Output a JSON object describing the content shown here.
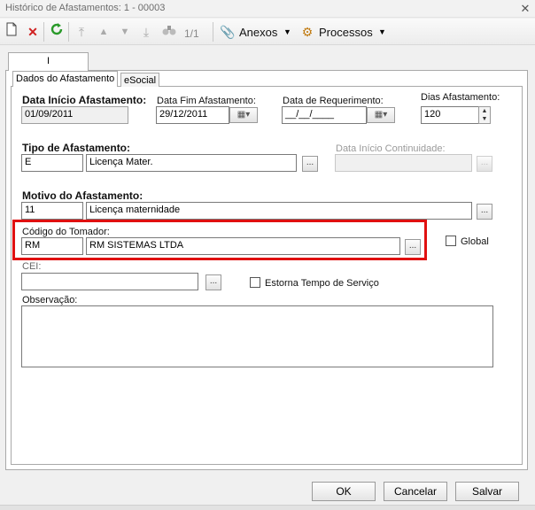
{
  "window": {
    "title": "Histórico de Afastamentos: 1 - 00003",
    "close_glyph": "✕"
  },
  "toolbar": {
    "new_icon": "new-document-icon",
    "delete_icon": "delete-icon",
    "refresh_icon": "refresh-icon",
    "nav_counter": "1/1",
    "anexos_label": "Anexos",
    "processos_label": "Processos"
  },
  "tabs": {
    "outer": "Identificação",
    "inner": [
      "Dados do Afastamento",
      "eSocial"
    ]
  },
  "form": {
    "data_inicio": {
      "label": "Data Início Afastamento:",
      "value": "01/09/2011"
    },
    "data_fim": {
      "label": "Data Fim Afastamento:",
      "value": "29/12/2011"
    },
    "data_requerimento": {
      "label": "Data de Requerimento:",
      "value": "__/__/____"
    },
    "dias_afastamento": {
      "label": "Dias Afastamento:",
      "value": "120"
    },
    "tipo_afastamento": {
      "label": "Tipo de Afastamento:",
      "code": "E",
      "description": "Licença Mater."
    },
    "data_inicio_continuidade": {
      "label": "Data Início Continuidade:",
      "value": ""
    },
    "motivo_afastamento": {
      "label": "Motivo do Afastamento:",
      "code": "11",
      "description": "Licença maternidade"
    },
    "codigo_tomador": {
      "label": "Código do Tomador:",
      "code": "RM",
      "description": "RM SISTEMAS LTDA"
    },
    "global": {
      "label": "Global",
      "checked": false
    },
    "cei": {
      "label": "CEI:",
      "value": ""
    },
    "estorna": {
      "label": "Estorna Tempo de Serviço",
      "checked": false
    },
    "observacao": {
      "label": "Observação:",
      "value": ""
    },
    "ellipsis": "..."
  },
  "buttons": {
    "ok": "OK",
    "cancel": "Cancelar",
    "save": "Salvar"
  },
  "colors": {
    "highlight": "#e01010"
  }
}
